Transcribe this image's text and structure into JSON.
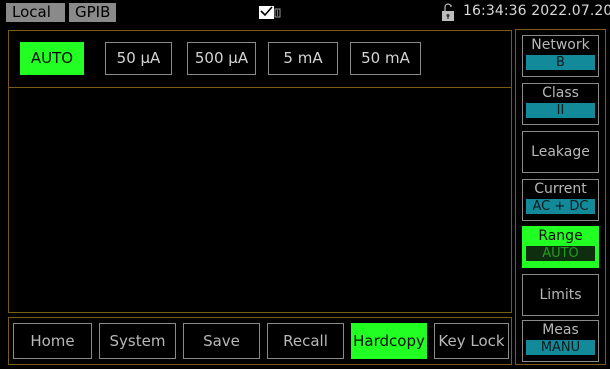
{
  "status_bar": {
    "mode": "Local",
    "interface": "GPIB",
    "datetime": "16:34:36 2022.07.20",
    "icons": [
      "mail-icon",
      "usb-icon",
      "lock-icon"
    ]
  },
  "range_selector": {
    "selected": "AUTO",
    "options": [
      "AUTO",
      "50 μA",
      "500 μA",
      "5 mA",
      "50 mA"
    ]
  },
  "bottom_menu": {
    "active": "Hardcopy",
    "items": [
      "Home",
      "System",
      "Save",
      "Recall",
      "Hardcopy",
      "Key Lock"
    ]
  },
  "side_menu": {
    "active": "Range",
    "items": [
      {
        "title": "Network",
        "value": "B"
      },
      {
        "title": "Class",
        "value": "II"
      },
      {
        "title": "Leakage",
        "value": ""
      },
      {
        "title": "Current",
        "value": "AC + DC"
      },
      {
        "title": "Range",
        "value": "AUTO"
      },
      {
        "title": "Limits",
        "value": ""
      },
      {
        "title": "Meas",
        "value": "MANU"
      }
    ]
  },
  "colors": {
    "active_green": "#22ff22",
    "value_teal": "#138a9a",
    "frame_amber": "#7a5c14",
    "button_border": "#8a8a8a"
  }
}
